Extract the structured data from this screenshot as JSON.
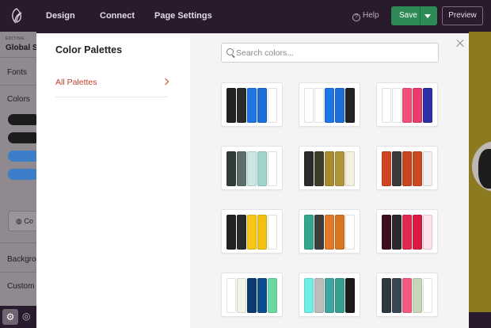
{
  "topbar": {
    "nav": [
      "Design",
      "Connect",
      "Page Settings"
    ],
    "help_label": "Help",
    "save_label": "Save",
    "preview_label": "Preview"
  },
  "sidebar": {
    "editing_label": "EDITING",
    "global_label": "Global S",
    "fonts_label": "Fonts",
    "colors_label": "Colors",
    "color_button_label": "Co",
    "background_label": "Backgro",
    "custom_label": "Custom",
    "pill_colors": [
      "#1c1c1c",
      "#1c1c1c",
      "#3d7ec8",
      "#3d7ec8"
    ]
  },
  "modal": {
    "title": "Color Palettes",
    "nav_item": "All Palettes",
    "search_placeholder": "Search colors...",
    "palettes": [
      [
        "#222222",
        "#2b2b2b",
        "#1f75e6",
        "#1a6fd9",
        "#ffffff"
      ],
      [
        "#ffffff",
        "#ffffff",
        "#1f75e6",
        "#1a6fd9",
        "#222222"
      ],
      [
        "#ffffff",
        "#ffffff",
        "#f0507a",
        "#ea3c6a",
        "#2d2fa6"
      ],
      [
        "#2f3d3b",
        "#5b6e6a",
        "#c9e8e2",
        "#9fd6cc",
        "#ffffff"
      ],
      [
        "#2a2a2a",
        "#3d3d2a",
        "#a88a30",
        "#b0943a",
        "#f5efdf"
      ],
      [
        "#cf4524",
        "#3a3a3a",
        "#c7451f",
        "#cc4a22",
        "#f2f2f2"
      ],
      [
        "#222222",
        "#2b2b2b",
        "#f5c518",
        "#f2c00f",
        "#ffffff"
      ],
      [
        "#35a58d",
        "#3d3d3d",
        "#e07a2a",
        "#d9741f",
        "#ffffff"
      ],
      [
        "#3d0f1c",
        "#2a2a2a",
        "#e0294f",
        "#d91b44",
        "#fbe3e8"
      ],
      [
        "#ffffff",
        "#eef5e8",
        "#0d3a6e",
        "#0b4e8f",
        "#6ad8a0"
      ],
      [
        "#6ef0e6",
        "#bdbdbd",
        "#3fa59e",
        "#35a090",
        "#1a1a1a"
      ],
      [
        "#2e3840",
        "#3a4652",
        "#f25a7e",
        "#c7d6b8",
        "#ffffff"
      ]
    ]
  }
}
